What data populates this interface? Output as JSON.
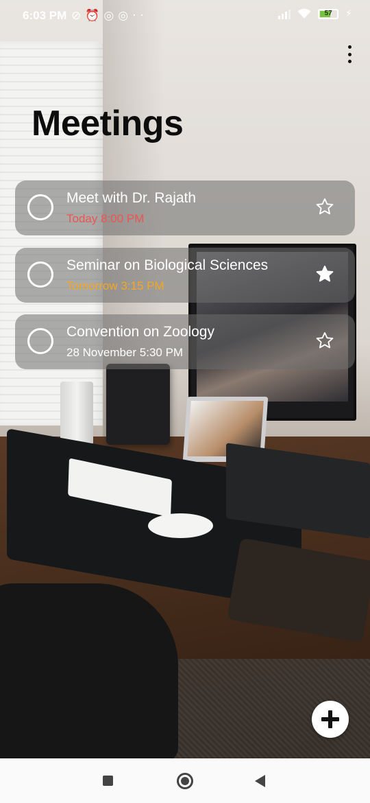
{
  "status_bar": {
    "time": "6:03 PM",
    "left_icons": [
      "mute-icon",
      "alarm-icon",
      "app-icon",
      "app-icon",
      "more-dots-icon"
    ],
    "battery_level": "57",
    "battery_color": "#7ac142"
  },
  "header": {
    "title": "Meetings",
    "menu_icon": "more-vert-icon"
  },
  "meetings": [
    {
      "name": "Meet with Dr. Rajath",
      "when": "Today  8:00 PM",
      "when_color": "#ef5350",
      "starred": false
    },
    {
      "name": "Seminar on Biological Sciences",
      "when": "Tomorrow  3:15 PM",
      "when_color": "#f5a623",
      "starred": true
    },
    {
      "name": "Convention on Zoology",
      "when": "28 November  5:30 PM",
      "when_color": "#ffffff",
      "starred": false
    }
  ],
  "fab": {
    "icon": "plus-icon"
  },
  "nav_bar": {
    "items": [
      "recent-apps-icon",
      "home-icon",
      "back-icon"
    ]
  }
}
